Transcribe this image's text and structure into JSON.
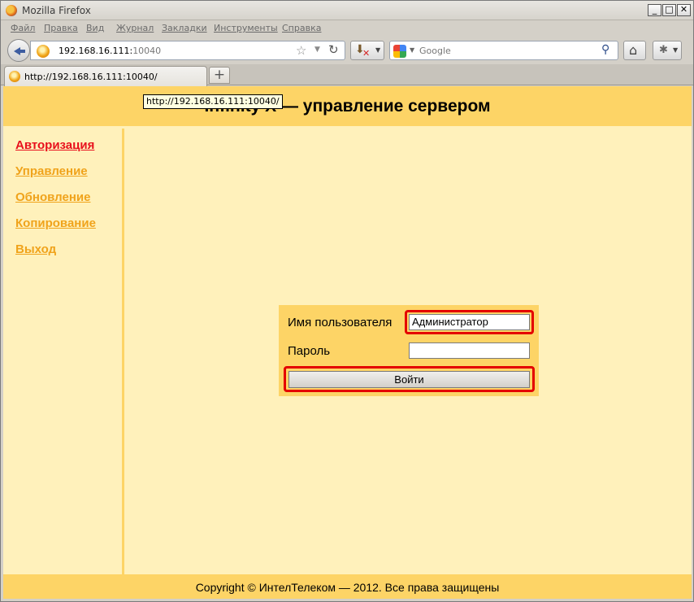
{
  "window": {
    "title": "Mozilla Firefox",
    "controls": {
      "minimize": "_",
      "maximize": "□",
      "close": "✕"
    }
  },
  "menu": [
    "Файл",
    "Правка",
    "Вид",
    "Журнал",
    "Закладки",
    "Инструменты",
    "Справка"
  ],
  "urlbar": {
    "host": "192.168.16.111:",
    "port": "10040"
  },
  "search": {
    "engine_icon": "google-icon",
    "placeholder": "Google"
  },
  "tab": {
    "label": "http://192.168.16.111:10040/",
    "new_tab": "+"
  },
  "tooltip": "http://192.168.16.111:10040/",
  "page": {
    "title": "Infinity X — управление сервером",
    "sidebar": [
      {
        "label": "Авторизация",
        "active": true
      },
      {
        "label": "Управление",
        "active": false
      },
      {
        "label": "Обновление",
        "active": false
      },
      {
        "label": "Копирование",
        "active": false
      },
      {
        "label": "Выход",
        "active": false
      }
    ],
    "login": {
      "username_label": "Имя пользователя",
      "username_value": "Администратор",
      "password_label": "Пароль",
      "password_value": "",
      "submit_label": "Войти"
    },
    "footer": "Copyright © ИнтелТелеком — 2012. Все права защищены"
  },
  "colors": {
    "page_bg": "#fff1bb",
    "header_bg": "#fdd466",
    "link": "#f0a31b",
    "link_active": "#e8101c",
    "highlight": "#e40000"
  }
}
